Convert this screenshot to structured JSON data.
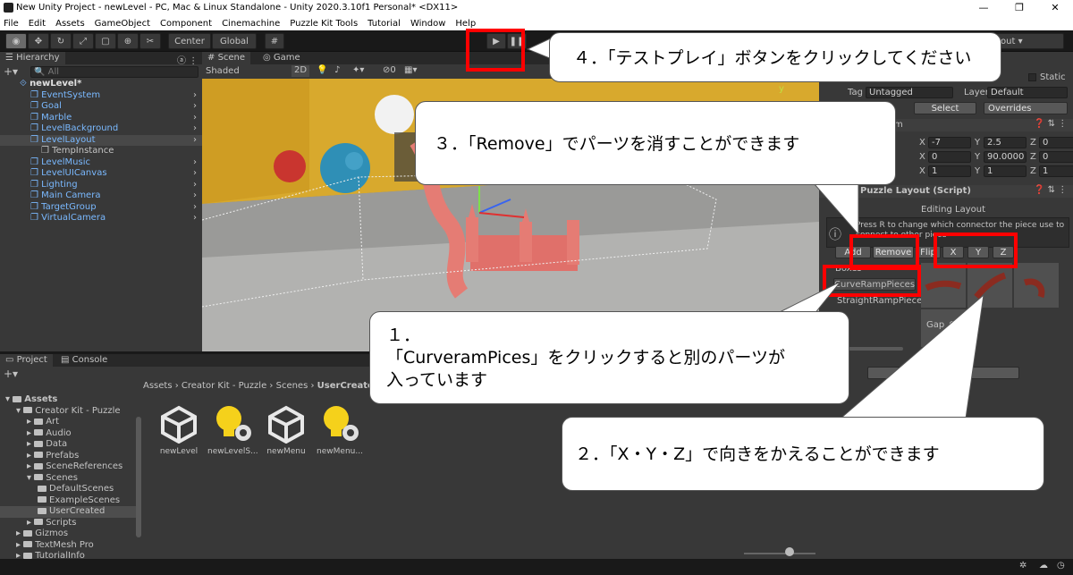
{
  "window": {
    "title": "New Unity Project - newLevel - PC, Mac & Linux Standalone - Unity 2020.3.10f1 Personal* <DX11>"
  },
  "menu": [
    "File",
    "Edit",
    "Assets",
    "GameObject",
    "Component",
    "Cinemachine",
    "Puzzle Kit Tools",
    "Tutorial",
    "Window",
    "Help"
  ],
  "toolbar": {
    "center_label": "Center",
    "global_label": "Global",
    "layout_label": "out"
  },
  "hierarchy": {
    "tab": "Hierarchy",
    "search_placeholder": "All",
    "items": [
      {
        "label": "newLevel*",
        "indent": 0
      },
      {
        "label": "EventSystem",
        "indent": 1
      },
      {
        "label": "Goal",
        "indent": 1
      },
      {
        "label": "Marble",
        "indent": 1
      },
      {
        "label": "LevelBackground",
        "indent": 1
      },
      {
        "label": "LevelLayout",
        "indent": 1
      },
      {
        "label": "TempInstance",
        "indent": 2
      },
      {
        "label": "LevelMusic",
        "indent": 1
      },
      {
        "label": "LevelUICanvas",
        "indent": 1
      },
      {
        "label": "Lighting",
        "indent": 1
      },
      {
        "label": "Main Camera",
        "indent": 1
      },
      {
        "label": "TargetGroup",
        "indent": 1
      },
      {
        "label": "VirtualCamera",
        "indent": 1
      }
    ]
  },
  "scene": {
    "tab_scene": "Scene",
    "tab_game": "Game",
    "shading": "Shaded",
    "mode_2d": "2D",
    "gizmo_count": "0",
    "axis_y": "y"
  },
  "inspector": {
    "static_label": "Static",
    "tag_label": "Tag",
    "tag_value": "Untagged",
    "layer_label": "Layer",
    "layer_value": "Default",
    "select_label": "Select",
    "overrides_label": "Overrides",
    "transform_header": "m",
    "rows": [
      {
        "x": "-7",
        "y": "2.5",
        "z": "0"
      },
      {
        "x": "0",
        "y": "90.0000",
        "z": "0"
      },
      {
        "x": "1",
        "y": "1",
        "z": "1"
      }
    ],
    "script_header": "Puzzle Layout (Script)",
    "editing_layout": "Editing Layout",
    "help_line1": "Press R to change which connector the piece use to",
    "help_line2": "connect to other piece",
    "add_label": "Add",
    "remove_label": "Remove",
    "flip_label": "Flip",
    "x_label": "X",
    "y_label": "Y",
    "z_label": "Z",
    "boxes_label": "Boxes",
    "curve_label": "CurveRampPieces",
    "straight_label": "StraightRampPieces",
    "gap_label": "Gap_C",
    "bottom_button": "nt"
  },
  "project": {
    "tab_project": "Project",
    "tab_console": "Console",
    "breadcrumb": [
      "Assets",
      "Creator Kit - Puzzle",
      "Scenes",
      "UserCreate"
    ],
    "tree": [
      {
        "label": "Assets",
        "indent": 0
      },
      {
        "label": "Creator Kit - Puzzle",
        "indent": 1
      },
      {
        "label": "Art",
        "indent": 2
      },
      {
        "label": "Audio",
        "indent": 2
      },
      {
        "label": "Data",
        "indent": 2
      },
      {
        "label": "Prefabs",
        "indent": 2
      },
      {
        "label": "SceneReferences",
        "indent": 2
      },
      {
        "label": "Scenes",
        "indent": 2
      },
      {
        "label": "DefaultScenes",
        "indent": 3
      },
      {
        "label": "ExampleScenes",
        "indent": 3
      },
      {
        "label": "UserCreated",
        "indent": 3
      },
      {
        "label": "Scripts",
        "indent": 2
      },
      {
        "label": "Gizmos",
        "indent": 1
      },
      {
        "label": "TextMesh Pro",
        "indent": 1
      },
      {
        "label": "TutorialInfo",
        "indent": 1
      }
    ],
    "assets": [
      {
        "label": "newLevel",
        "icon": "unity-scene-icon"
      },
      {
        "label": "newLevelS...",
        "icon": "lighting-settings-icon"
      },
      {
        "label": "newMenu",
        "icon": "unity-scene-icon"
      },
      {
        "label": "newMenu...",
        "icon": "lighting-settings-icon"
      }
    ]
  },
  "callouts": {
    "c4": "４．「テストプレイ」ボタンをクリックしてください",
    "c3": "３．「Remove」でパーツを消すことができます",
    "c1_line1": "１．",
    "c1_line2": "「CurveramPices」をクリックすると別のパーツが",
    "c1_line3": "入っています",
    "c2": "２．「X・Y・Z」で向きをかえることができます"
  },
  "colors": {
    "highlight_red": "#ff0000",
    "hierarchy_blue": "#7ab9ff",
    "panel": "#383838"
  }
}
